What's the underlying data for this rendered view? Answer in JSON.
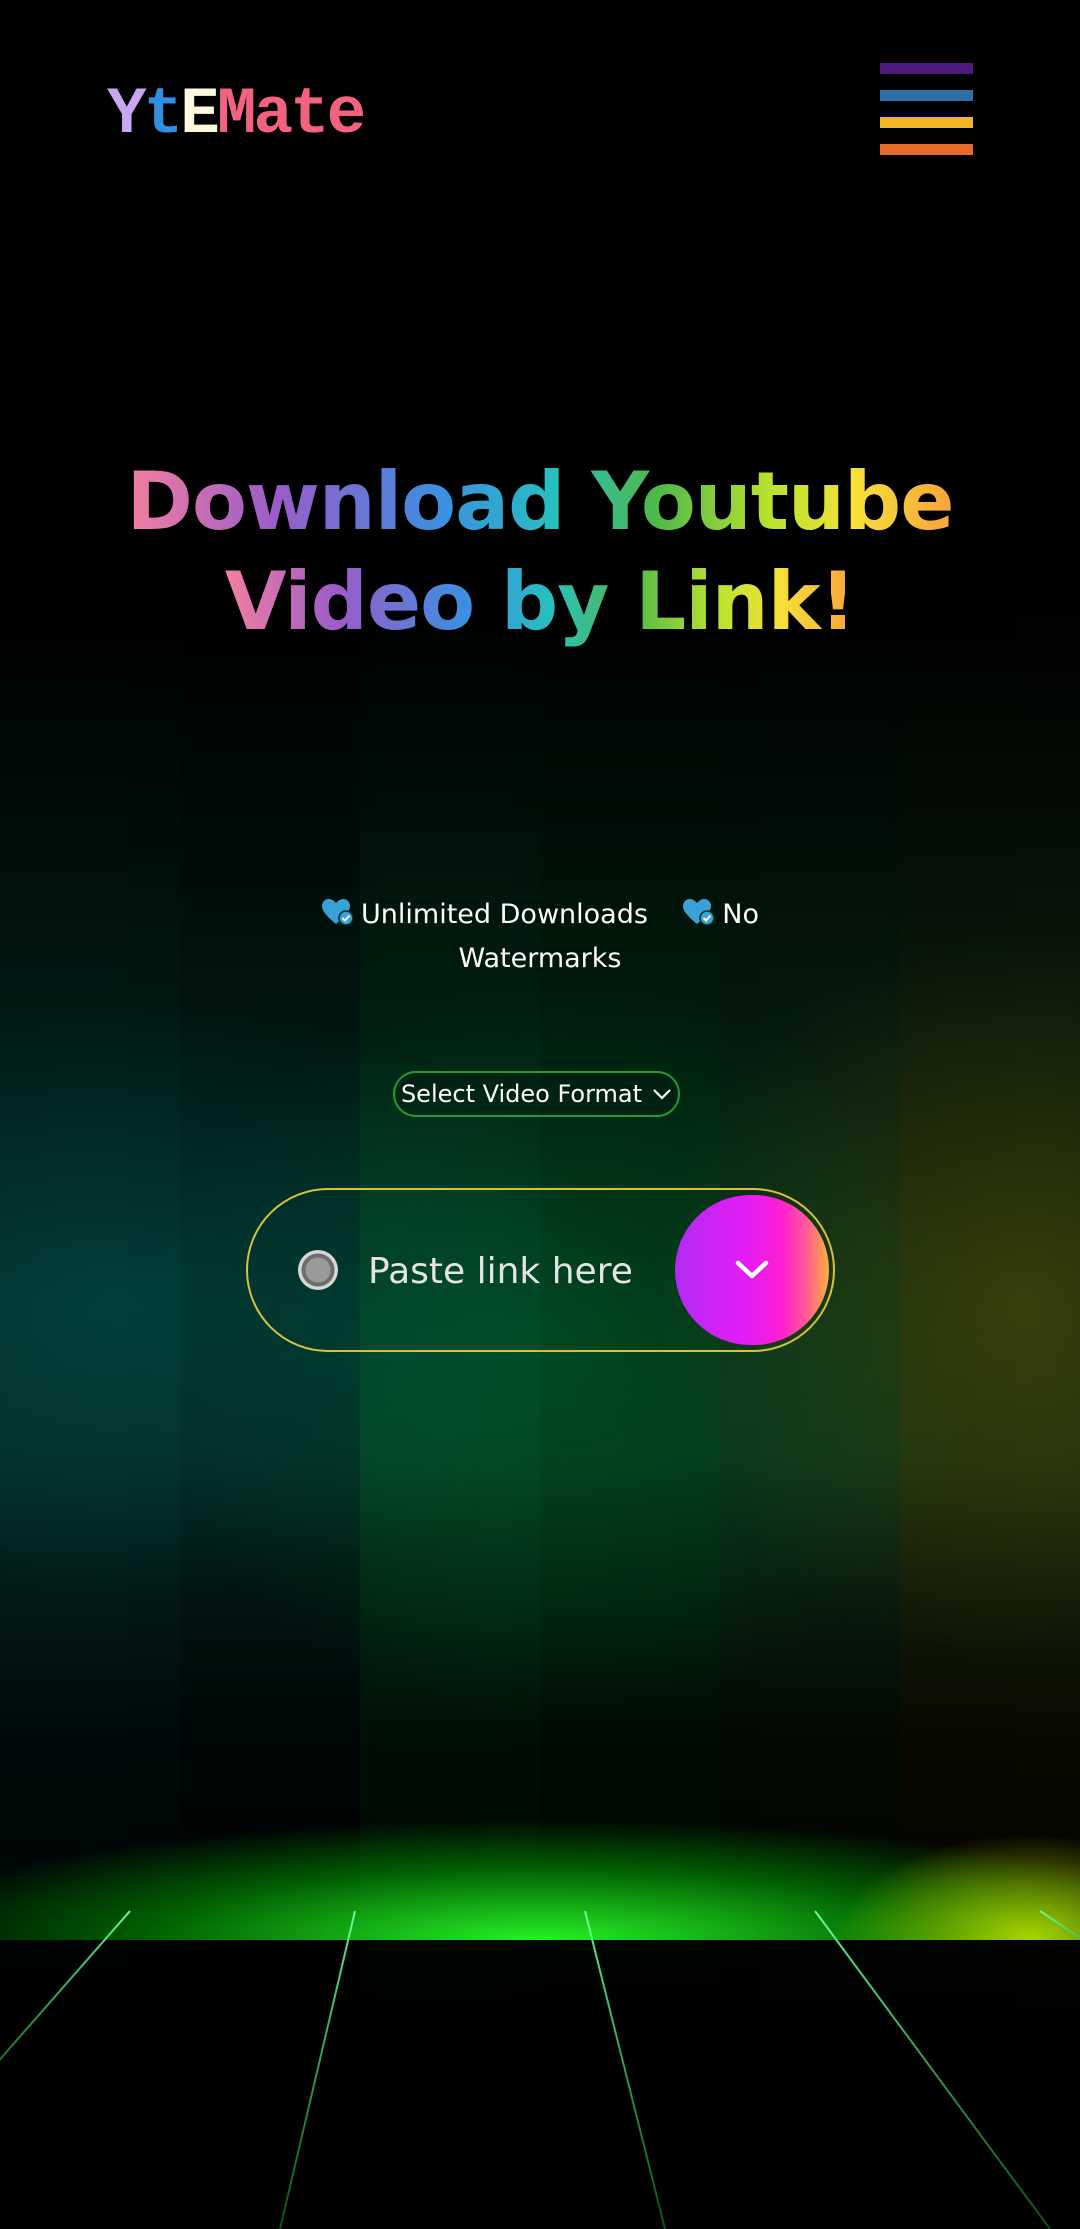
{
  "header": {
    "logo": [
      "Y",
      "t",
      "E",
      "M",
      "a",
      "t",
      "e"
    ],
    "logo_colors": [
      "#c9a7f1",
      "#2f8fe3",
      "#fff8dc",
      "#f3627f",
      "#f3627f",
      "#f3627f",
      "#f3627f"
    ],
    "menu_icon": "hamburger-menu-icon",
    "menu_bar_colors": [
      "#4b1a7c",
      "#2e6fa5",
      "#f0b62a",
      "#e86a2b"
    ]
  },
  "hero": {
    "line1": "Download Youtube",
    "line2": "Video by Link!"
  },
  "features": [
    {
      "icon": "heart-check-icon",
      "text": "Unlimited Downloads"
    },
    {
      "icon": "heart-check-icon",
      "text": "No Watermarks"
    }
  ],
  "format_select": {
    "label": "Select Video Format",
    "icon": "chevron-down-icon"
  },
  "link_input": {
    "placeholder": "Paste link here",
    "radio_icon": "radio-icon",
    "submit_icon": "chevron-down-icon"
  },
  "colors": {
    "pill_border": "#d9c23a",
    "select_border": "#1f9a3a",
    "grid": "#2bff5a"
  }
}
